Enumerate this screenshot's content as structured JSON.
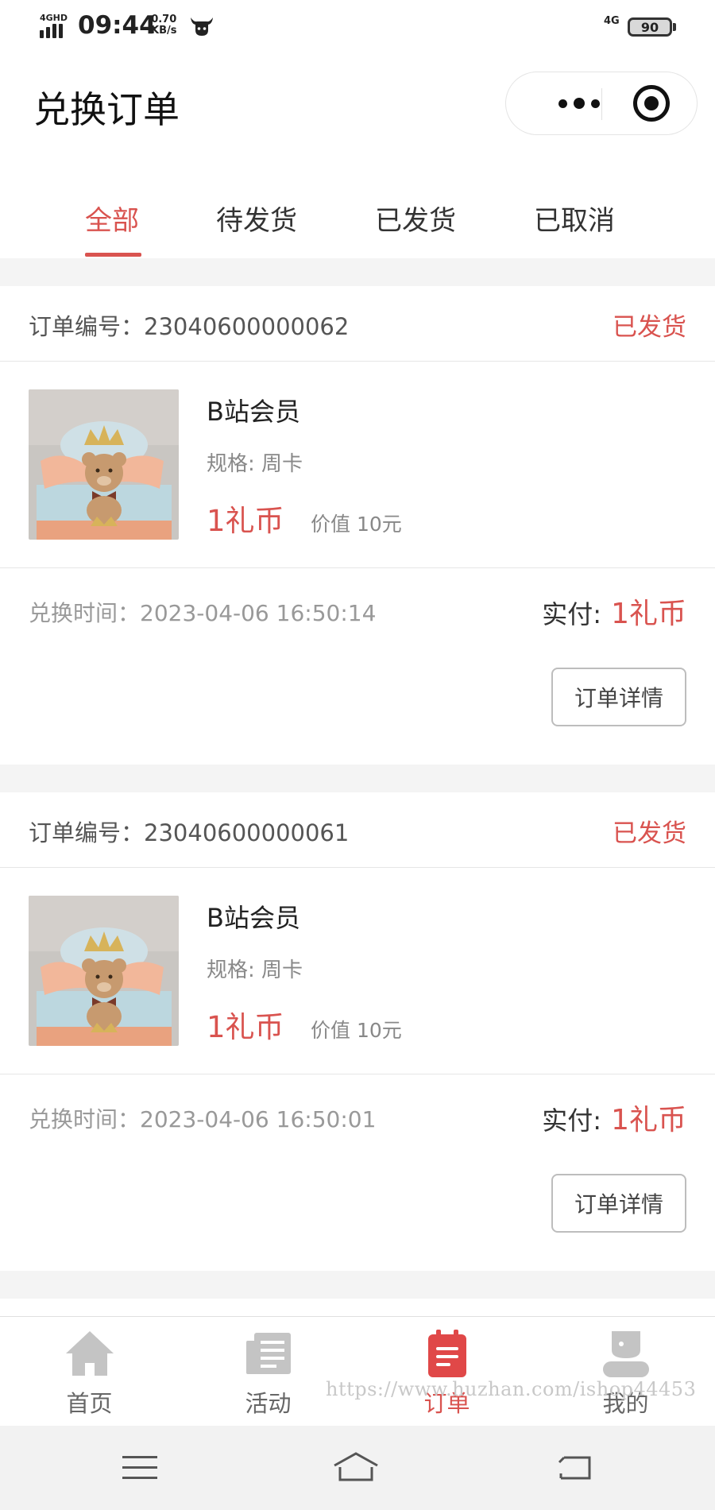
{
  "status_bar": {
    "signal_label": "4GHD",
    "time": "09:44",
    "net_speed": "0.70",
    "net_unit": "KB/s",
    "network": "4G",
    "battery": "90"
  },
  "header": {
    "title": "兑换订单",
    "more_icon": "more-dots-icon",
    "close_icon": "target-circle-icon"
  },
  "tabs": [
    {
      "label": "全部",
      "active": true
    },
    {
      "label": "待发货",
      "active": false
    },
    {
      "label": "已发货",
      "active": false
    },
    {
      "label": "已取消",
      "active": false
    }
  ],
  "orders": [
    {
      "order_no_label": "订单编号：",
      "order_no": "23040600000062",
      "status": "已发货",
      "product_name": "B站会员",
      "spec": "规格: 周卡",
      "price": "1礼币",
      "worth": "价值 10元",
      "exchange_time_label": "兑换时间：",
      "exchange_time": "2023-04-06 16:50:14",
      "paid_label": "实付:",
      "paid_amount": "1礼币",
      "detail_button": "订单详情"
    },
    {
      "order_no_label": "订单编号：",
      "order_no": "23040600000061",
      "status": "已发货",
      "product_name": "B站会员",
      "spec": "规格: 周卡",
      "price": "1礼币",
      "worth": "价值 10元",
      "exchange_time_label": "兑换时间：",
      "exchange_time": "2023-04-06 16:50:01",
      "paid_label": "实付:",
      "paid_amount": "1礼币",
      "detail_button": "订单详情"
    }
  ],
  "bottom_nav": [
    {
      "label": "首页",
      "icon": "home-icon",
      "active": false
    },
    {
      "label": "活动",
      "icon": "document-icon",
      "active": false
    },
    {
      "label": "订单",
      "icon": "clipboard-icon",
      "active": true
    },
    {
      "label": "我的",
      "icon": "user-icon",
      "active": false
    }
  ],
  "watermark": "https://www.huzhan.com/ishop44453",
  "colors": {
    "accent": "#d9534f",
    "background_gap": "#f4f4f4",
    "inactive_icon": "#c4c4c4"
  }
}
